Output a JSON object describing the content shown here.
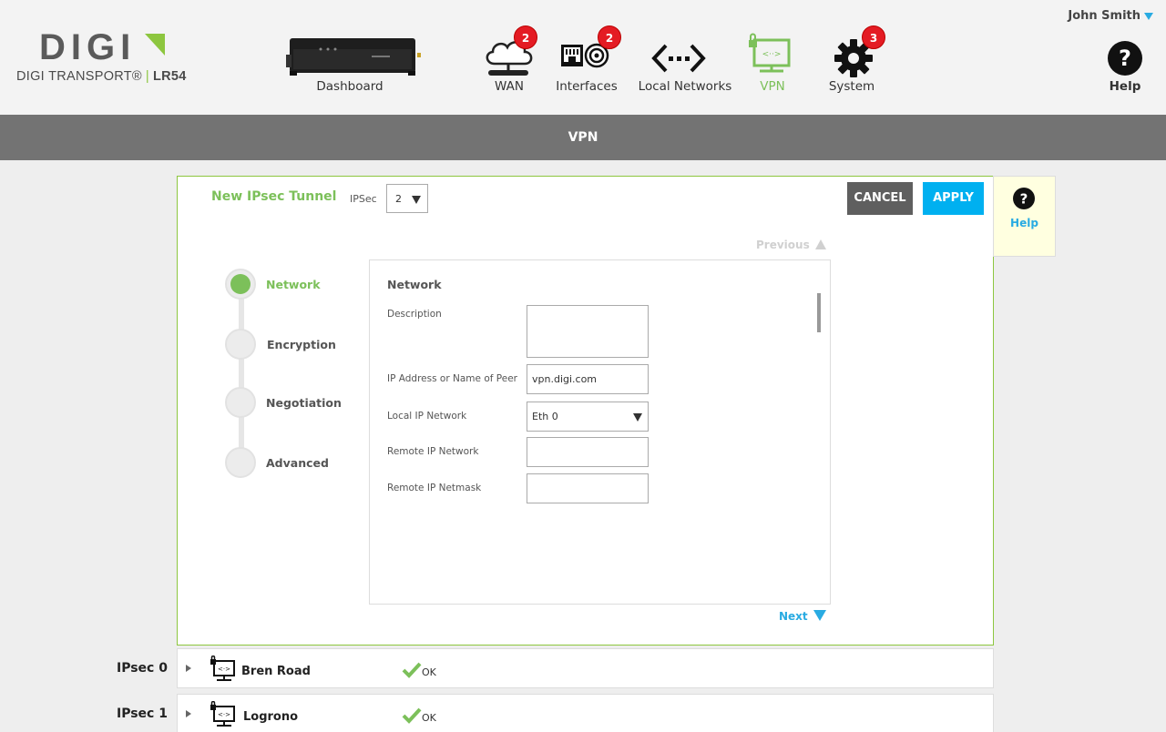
{
  "header": {
    "brand": "DIGI",
    "product_name": "DIGI TRANSPORT®",
    "model": "LR54",
    "user": "John Smith",
    "nav": [
      {
        "label": "Dashboard",
        "icon": "router-device-icon"
      },
      {
        "label": "WAN",
        "icon": "cloud-icon",
        "badge": "2"
      },
      {
        "label": "Interfaces",
        "icon": "ethernet-port-icon",
        "badge": "2"
      },
      {
        "label": "Local Networks",
        "icon": "network-arrows-icon"
      },
      {
        "label": "VPN",
        "icon": "vpn-monitor-icon",
        "active": true
      },
      {
        "label": "System",
        "icon": "gear-icon",
        "badge": "3"
      }
    ],
    "help_label": "Help"
  },
  "title_bar": "VPN",
  "panel": {
    "title": "New IPsec Tunnel",
    "ipsec_label": "IPSec",
    "ipsec_value": "2",
    "cancel_label": "CANCEL",
    "apply_label": "APPLY",
    "previous_label": "Previous",
    "next_label": "Next",
    "steps": [
      {
        "label": "Network",
        "active": true
      },
      {
        "label": "Encryption"
      },
      {
        "label": "Negotiation"
      },
      {
        "label": "Advanced"
      }
    ],
    "form": {
      "title": "Network",
      "fields": {
        "description": {
          "label": "Description",
          "value": ""
        },
        "peer": {
          "label": "IP Address or Name of Peer",
          "value": "vpn.digi.com"
        },
        "local_network": {
          "label": "Local IP Network",
          "value": "Eth 0"
        },
        "remote_network": {
          "label": "Remote IP Network",
          "value": ""
        },
        "remote_netmask": {
          "label": "Remote IP Netmask",
          "value": ""
        }
      }
    }
  },
  "help_side": {
    "label": "Help"
  },
  "tunnels": [
    {
      "id_label": "IPsec 0",
      "name": "Bren Road",
      "status": "OK"
    },
    {
      "id_label": "IPsec 1",
      "name": "Logrono",
      "status": "OK"
    }
  ],
  "colors": {
    "accent_green": "#7cc05a",
    "accent_blue": "#00b0f0",
    "badge_red": "#e41b23",
    "title_bar": "#737373"
  }
}
